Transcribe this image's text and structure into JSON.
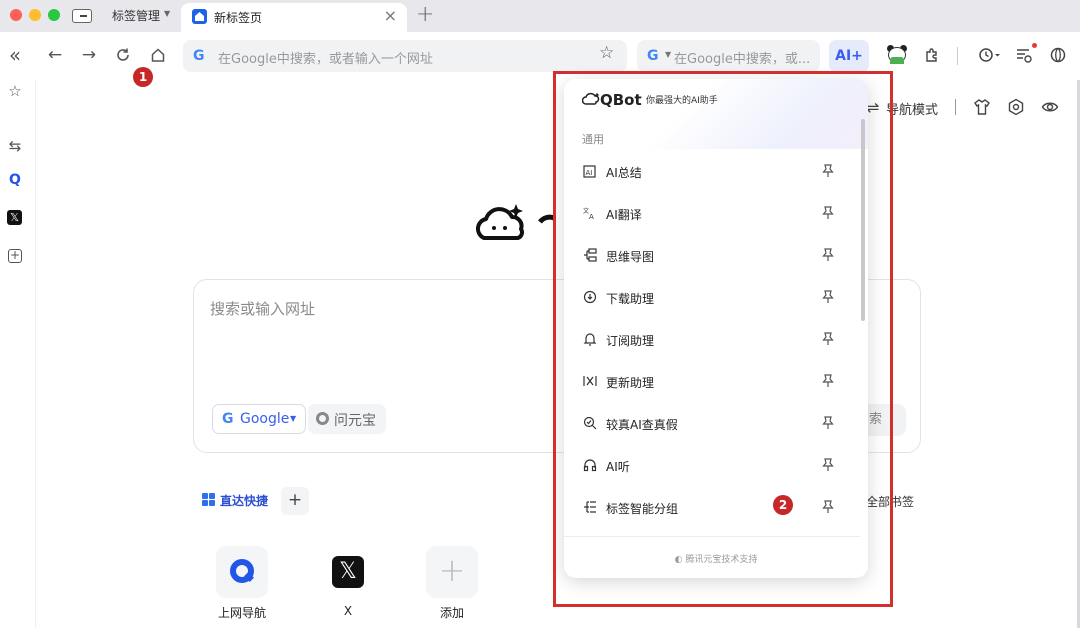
{
  "tabbar": {
    "group_label": "标签管理",
    "active_tab_title": "新标签页"
  },
  "toolbar": {
    "omnibox_placeholder": "在Google中搜索，或者输入一个网址",
    "search_placeholder": "在Google中搜索，或...",
    "ai_button_label": "AI+"
  },
  "annotations": {
    "badge1": "1",
    "badge2": "2",
    "accent_color": "#d32f2f"
  },
  "right_nav": {
    "nav_mode_label": "导航模式"
  },
  "newtab": {
    "search_placeholder": "搜索或输入网址",
    "engine_google": "Google",
    "engine_wenyuanbao": "问元宝",
    "search_button_partial": "索",
    "quick_access_label": "直达快捷",
    "all_bookmarks_label": "全部书签",
    "shortcuts": [
      {
        "label": "上网导航",
        "icon": "qq-browser-icon"
      },
      {
        "label": "X",
        "icon": "x-logo-icon"
      },
      {
        "label": "添加",
        "icon": "plus-icon"
      }
    ]
  },
  "qbot": {
    "brand": "QBot",
    "tagline": "你最强大的AI助手",
    "section_title": "通用",
    "items": [
      {
        "label": "AI总结",
        "icon": "ai-summary-icon"
      },
      {
        "label": "AI翻译",
        "icon": "ai-translate-icon"
      },
      {
        "label": "思维导图",
        "icon": "mindmap-icon"
      },
      {
        "label": "下载助理",
        "icon": "download-assistant-icon"
      },
      {
        "label": "订阅助理",
        "icon": "subscribe-assistant-icon"
      },
      {
        "label": "更新助理",
        "icon": "update-assistant-icon"
      },
      {
        "label": "较真AI查真假",
        "icon": "fact-check-icon"
      },
      {
        "label": "AI听",
        "icon": "ai-listen-icon"
      },
      {
        "label": "标签智能分组",
        "icon": "tab-grouping-icon"
      }
    ],
    "footer": "腾讯元宝技术支持"
  }
}
